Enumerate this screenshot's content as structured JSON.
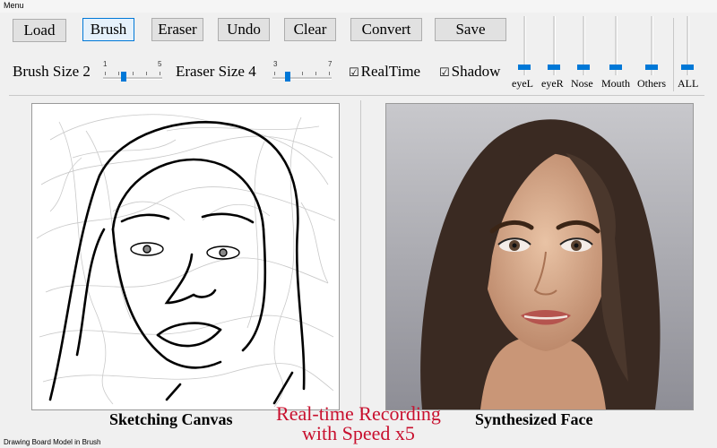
{
  "menu": {
    "label": "Menu"
  },
  "toolbar": {
    "load": "Load",
    "brush": "Brush",
    "eraser": "Eraser",
    "undo": "Undo",
    "clear": "Clear",
    "convert": "Convert",
    "save": "Save",
    "active_tool": "Brush"
  },
  "brush_size": {
    "label": "Brush Size",
    "value": "2",
    "min": "1",
    "max": "5",
    "level": 0.25
  },
  "eraser_size": {
    "label": "Eraser Size",
    "value": "4",
    "min": "3",
    "max": "7",
    "level": 0.25
  },
  "options": {
    "realtime": "RealTime",
    "shadow": "Shadow",
    "realtime_checked": true,
    "shadow_checked": true
  },
  "feature_sliders": [
    {
      "label": "eyeL"
    },
    {
      "label": "eyeR"
    },
    {
      "label": "Nose"
    },
    {
      "label": "Mouth"
    },
    {
      "label": "Others"
    },
    {
      "label": "ALL"
    }
  ],
  "panels": {
    "left_caption": "Sketching Canvas",
    "right_caption": "Synthesized Face"
  },
  "overlay": {
    "line1": "Real-time Recording",
    "line2": "with Speed x5"
  },
  "status": {
    "text": "Drawing Board Model in Brush"
  },
  "colors": {
    "accent": "#0078d7",
    "overlay_text": "#c8102e"
  }
}
